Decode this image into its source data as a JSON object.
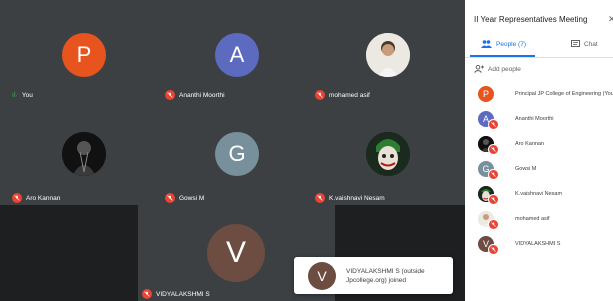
{
  "meeting": {
    "tiles": [
      {
        "id": "you",
        "initial": "P",
        "name": "You",
        "color": "#e8541e",
        "state": "speaking"
      },
      {
        "id": "ananthi",
        "initial": "A",
        "name": "Ananthi Moorthi",
        "color": "#5c6bc0",
        "state": "muted"
      },
      {
        "id": "asif",
        "initial": "",
        "name": "mohamed asif",
        "photo": "person-photo",
        "state": "muted"
      },
      {
        "id": "aro",
        "initial": "",
        "name": "Aro Kannan",
        "photo": "dark-portrait-photo",
        "state": "muted"
      },
      {
        "id": "gowsi",
        "initial": "G",
        "name": "Gowsi M",
        "color": "#78909c",
        "state": "muted"
      },
      {
        "id": "vaishnavi",
        "initial": "",
        "name": "K.vaishnavi Nesam",
        "photo": "joker-photo",
        "state": "muted"
      },
      {
        "id": "vidya",
        "initial": "V",
        "name": "VIDYALAKSHMI S",
        "color": "#6d4c41",
        "state": "muted"
      }
    ]
  },
  "toast": {
    "initial": "V",
    "color": "#6d4c41",
    "message": "VIDYALAKSHMI S (outside Jpcollege.org) joined"
  },
  "panel": {
    "title": "II Year Representatives Meeting",
    "close_icon": "close-icon",
    "people_tab": "People (7)",
    "chat_tab": "Chat",
    "add_people": "Add people",
    "participants": [
      {
        "initial": "P",
        "color": "#e8541e",
        "name": "Principal JP College of Engineering (You)",
        "state": "speaking"
      },
      {
        "initial": "A",
        "color": "#5c6bc0",
        "name": "Ananthi Moorthi",
        "state": "muted"
      },
      {
        "initial": "",
        "photo": "dark-portrait-photo",
        "name": "Aro Kannan",
        "state": "muted"
      },
      {
        "initial": "G",
        "color": "#78909c",
        "name": "Gowsi M",
        "state": "muted"
      },
      {
        "initial": "",
        "photo": "joker-photo",
        "name": "K.vaishnavi Nesam",
        "state": "muted"
      },
      {
        "initial": "",
        "photo": "person-photo",
        "name": "mohamed asif",
        "state": "muted"
      },
      {
        "initial": "V",
        "color": "#6d4c41",
        "name": "VIDYALAKSHMI S",
        "state": "muted"
      }
    ]
  },
  "colors": {
    "accent": "#1a73e8",
    "muted": "#ea4335",
    "speaking": "#34a853"
  }
}
